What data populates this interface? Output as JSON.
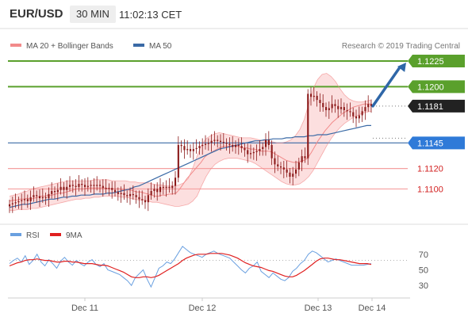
{
  "header": {
    "pair": "EUR/USD",
    "timeframe": "30 MIN",
    "time": "11:02:13 CET"
  },
  "legend": {
    "bollinger": "MA 20 + Bollinger Bands",
    "ma50": "MA 50",
    "credit": "Research © 2019 Trading Central",
    "rsi": "RSI",
    "ma9": "9MA"
  },
  "colors": {
    "candle": "#8b1a1a",
    "bollinger": "#f28b8b",
    "bollinger_fill": "#fbd9d9",
    "ma50": "#3a6aa6",
    "green_line": "#5aa02c",
    "blue_level": "#2f7ad8",
    "red_level": "#f5a0a0",
    "arrow": "#2f67a8",
    "rsi": "#6aa0e0",
    "rsi_ma": "#e02020"
  },
  "chart_data": [
    {
      "type": "candlestick",
      "title": "EUR/USD",
      "timeframe": "30 MIN",
      "x_ticks": [
        "Dec 11",
        "Dec 12",
        "Dec 13",
        "Dec 14"
      ],
      "ylim": [
        1.1074,
        1.1232
      ],
      "price_labels": [
        {
          "id": "r2",
          "value": 1.1225,
          "text": "1.1225",
          "style": "green-filled"
        },
        {
          "id": "r1",
          "value": 1.12,
          "text": "1.1200",
          "style": "green-filled"
        },
        {
          "id": "last",
          "value": 1.1181,
          "text": "1.1181",
          "style": "dark-filled"
        },
        {
          "id": "pivot",
          "value": 1.1145,
          "text": "1.1145",
          "style": "blue-filled"
        },
        {
          "id": "s1",
          "value": 1.112,
          "text": "1.1120",
          "style": "red-text"
        },
        {
          "id": "s2",
          "value": 1.11,
          "text": "1.1100",
          "style": "red-text"
        }
      ],
      "close": [
        1.1085,
        1.1086,
        1.1087,
        1.1088,
        1.1089,
        1.109,
        1.1088,
        1.1092,
        1.1094,
        1.1093,
        1.1091,
        1.1092,
        1.1091,
        1.1095,
        1.1098,
        1.1097,
        1.1099,
        1.1102,
        1.1099,
        1.1102,
        1.1104,
        1.1103,
        1.1102,
        1.1105,
        1.1104,
        1.1102,
        1.1103,
        1.1104,
        1.1103,
        1.1104,
        1.1103,
        1.1101,
        1.11,
        1.1101,
        1.1099,
        1.1097,
        1.1095,
        1.1096,
        1.1094,
        1.1093,
        1.1095,
        1.1094,
        1.1092,
        1.109,
        1.1089,
        1.1087,
        1.1094,
        1.1098,
        1.11,
        1.1097,
        1.1102,
        1.1101,
        1.1102,
        1.1101,
        1.1103,
        1.1111,
        1.1143,
        1.1142,
        1.1138,
        1.1139,
        1.1137,
        1.1139,
        1.114,
        1.1142,
        1.1143,
        1.1144,
        1.1145,
        1.1147,
        1.1148,
        1.1147,
        1.1146,
        1.1145,
        1.1144,
        1.1143,
        1.1141,
        1.1143,
        1.1142,
        1.114,
        1.1138,
        1.1134,
        1.1135,
        1.1136,
        1.1137,
        1.1139,
        1.1141,
        1.1148,
        1.1143,
        1.113,
        1.1124,
        1.1122,
        1.1121,
        1.1119,
        1.1116,
        1.1112,
        1.1115,
        1.1119,
        1.1126,
        1.1132,
        1.113,
        1.1193,
        1.119,
        1.1191,
        1.1187,
        1.1184,
        1.118,
        1.1177,
        1.1179,
        1.1183,
        1.1181,
        1.1178,
        1.118,
        1.1177,
        1.1176,
        1.1175,
        1.1171,
        1.1169,
        1.1172,
        1.1176,
        1.118,
        1.1183,
        1.1181
      ],
      "ma20": [
        1.1088,
        1.1089,
        1.1089,
        1.109,
        1.109,
        1.1091,
        1.109,
        1.1091,
        1.1092,
        1.1093,
        1.1093,
        1.1094,
        1.1094,
        1.1095,
        1.1096,
        1.1096,
        1.1097,
        1.1098,
        1.1099,
        1.11,
        1.11,
        1.11,
        1.1101,
        1.1101,
        1.1101,
        1.1101,
        1.1101,
        1.1101,
        1.11,
        1.11,
        1.11,
        1.11,
        1.1099,
        1.1099,
        1.1099,
        1.1098,
        1.1097,
        1.1097,
        1.1096,
        1.1095,
        1.1094,
        1.1093,
        1.1093,
        1.1094,
        1.1094,
        1.1095,
        1.1095,
        1.1096,
        1.11,
        1.1105,
        1.111,
        1.1114,
        1.1118,
        1.1122,
        1.1126,
        1.1131,
        1.1134,
        1.1136,
        1.1138,
        1.114,
        1.1141,
        1.1142,
        1.1142,
        1.1142,
        1.1142,
        1.1141,
        1.114,
        1.114,
        1.1139,
        1.1139,
        1.1138,
        1.1137,
        1.1137,
        1.1137,
        1.1136,
        1.1134,
        1.1132,
        1.113,
        1.1128,
        1.1127,
        1.1126,
        1.1126,
        1.1127,
        1.1128,
        1.113,
        1.1135,
        1.1141,
        1.1147,
        1.1152,
        1.1157,
        1.1161,
        1.1165,
        1.1168,
        1.1171,
        1.1174,
        1.1176,
        1.1178,
        1.118,
        1.1181,
        1.1182,
        1.1183,
        1.1183,
        1.1183
      ],
      "band_upper": [
        1.1093,
        1.1094,
        1.1095,
        1.1097,
        1.1098,
        1.11,
        1.1101,
        1.1102,
        1.1103,
        1.1104,
        1.1105,
        1.1106,
        1.1107,
        1.1108,
        1.1108,
        1.1108,
        1.1108,
        1.1108,
        1.1108,
        1.1109,
        1.1109,
        1.1109,
        1.1109,
        1.1108,
        1.1108,
        1.1108,
        1.1108,
        1.1107,
        1.1107,
        1.1106,
        1.1106,
        1.1106,
        1.1105,
        1.1104,
        1.1104,
        1.1103,
        1.1103,
        1.1103,
        1.1104,
        1.1106,
        1.111,
        1.112,
        1.1132,
        1.1143,
        1.1149,
        1.1152,
        1.1154,
        1.1155,
        1.1154,
        1.1153,
        1.1152,
        1.1151,
        1.115,
        1.115,
        1.115,
        1.1149,
        1.1148,
        1.1147,
        1.1146,
        1.1146,
        1.1145,
        1.1145,
        1.1146,
        1.1148,
        1.1152,
        1.1158,
        1.1168,
        1.1183,
        1.1198,
        1.1207,
        1.1212,
        1.1213,
        1.121,
        1.1205,
        1.1198,
        1.1192,
        1.1188,
        1.1186,
        1.1185,
        1.1185,
        1.1186,
        1.1187
      ],
      "band_lower": [
        1.1079,
        1.1079,
        1.108,
        1.108,
        1.108,
        1.1081,
        1.1081,
        1.1082,
        1.1083,
        1.1084,
        1.1085,
        1.1086,
        1.1087,
        1.1088,
        1.1089,
        1.109,
        1.109,
        1.1091,
        1.1091,
        1.1092,
        1.1092,
        1.1093,
        1.1093,
        1.1093,
        1.1093,
        1.1092,
        1.1092,
        1.1091,
        1.109,
        1.1089,
        1.1089,
        1.1088,
        1.1087,
        1.1087,
        1.1086,
        1.1085,
        1.1084,
        1.1083,
        1.1083,
        1.1084,
        1.1085,
        1.1088,
        1.1093,
        1.1103,
        1.1112,
        1.1119,
        1.1124,
        1.1127,
        1.1129,
        1.113,
        1.113,
        1.113,
        1.1129,
        1.1128,
        1.1127,
        1.1125,
        1.1122,
        1.1119,
        1.1116,
        1.1113,
        1.111,
        1.1107,
        1.1105,
        1.1104,
        1.1104,
        1.1105,
        1.1108,
        1.1112,
        1.1118,
        1.1126,
        1.1134,
        1.1142,
        1.1149,
        1.1155,
        1.116,
        1.1164,
        1.1167,
        1.117,
        1.1172,
        1.1174,
        1.1175,
        1.1176
      ],
      "ma50": [
        1.1082,
        1.1083,
        1.1084,
        1.1085,
        1.1085,
        1.1086,
        1.1087,
        1.1088,
        1.1089,
        1.109,
        1.109,
        1.1091,
        1.1092,
        1.1092,
        1.1093,
        1.1093,
        1.1094,
        1.1094,
        1.1094,
        1.1095,
        1.1095,
        1.1095,
        1.1096,
        1.1096,
        1.1097,
        1.1098,
        1.1099,
        1.11,
        1.1102,
        1.1103,
        1.1105,
        1.1107,
        1.1109,
        1.1111,
        1.1113,
        1.1115,
        1.1117,
        1.1119,
        1.1121,
        1.1123,
        1.1125,
        1.1127,
        1.1129,
        1.1131,
        1.1133,
        1.1135,
        1.1137,
        1.1139,
        1.114,
        1.1141,
        1.1142,
        1.1143,
        1.1144,
        1.1145,
        1.1146,
        1.1147,
        1.1147,
        1.1148,
        1.1148,
        1.1149,
        1.1149,
        1.1149,
        1.115,
        1.115,
        1.1151,
        1.1151,
        1.1151,
        1.1152,
        1.1152,
        1.1153,
        1.1153,
        1.1153,
        1.1154,
        1.1155,
        1.1156,
        1.1157,
        1.1158,
        1.1159,
        1.116,
        1.1161,
        1.1162,
        1.1162
      ]
    },
    {
      "type": "line",
      "title": "RSI",
      "ylim": [
        20,
        85
      ],
      "y_ticks": [
        30,
        50,
        70
      ],
      "ref_line": 62,
      "series": [
        {
          "name": "RSI",
          "values": [
            58,
            62,
            65,
            60,
            68,
            57,
            62,
            70,
            60,
            55,
            63,
            58,
            52,
            61,
            66,
            60,
            56,
            62,
            58,
            55,
            60,
            63,
            57,
            54,
            58,
            50,
            48,
            46,
            44,
            40,
            36,
            30,
            40,
            45,
            50,
            38,
            28,
            40,
            52,
            55,
            60,
            58,
            64,
            72,
            80,
            76,
            72,
            70,
            68,
            66,
            70,
            72,
            74,
            71,
            69,
            67,
            65,
            60,
            55,
            50,
            46,
            52,
            55,
            60,
            48,
            44,
            40,
            46,
            42,
            38,
            36,
            40,
            48,
            52,
            58,
            62,
            70,
            74,
            72,
            68,
            64,
            60,
            62,
            64,
            62,
            60,
            58,
            56,
            56,
            56,
            56,
            57,
            58
          ]
        },
        {
          "name": "9MA",
          "values": [
            55,
            57,
            59,
            60,
            62,
            63,
            63,
            64,
            63,
            62,
            62,
            61,
            60,
            60,
            61,
            61,
            60,
            60,
            59,
            58,
            58,
            58,
            57,
            56,
            56,
            55,
            53,
            51,
            49,
            47,
            44,
            41,
            40,
            40,
            41,
            41,
            40,
            41,
            43,
            46,
            49,
            52,
            55,
            58,
            62,
            65,
            67,
            69,
            70,
            70,
            70,
            71,
            71,
            71,
            71,
            70,
            69,
            67,
            65,
            62,
            59,
            57,
            55,
            54,
            53,
            51,
            49,
            48,
            46,
            44,
            42,
            41,
            41,
            43,
            46,
            49,
            53,
            57,
            61,
            64,
            65,
            65,
            64,
            63,
            63,
            62,
            61,
            60,
            59,
            58,
            58,
            58,
            57
          ]
        }
      ]
    }
  ]
}
